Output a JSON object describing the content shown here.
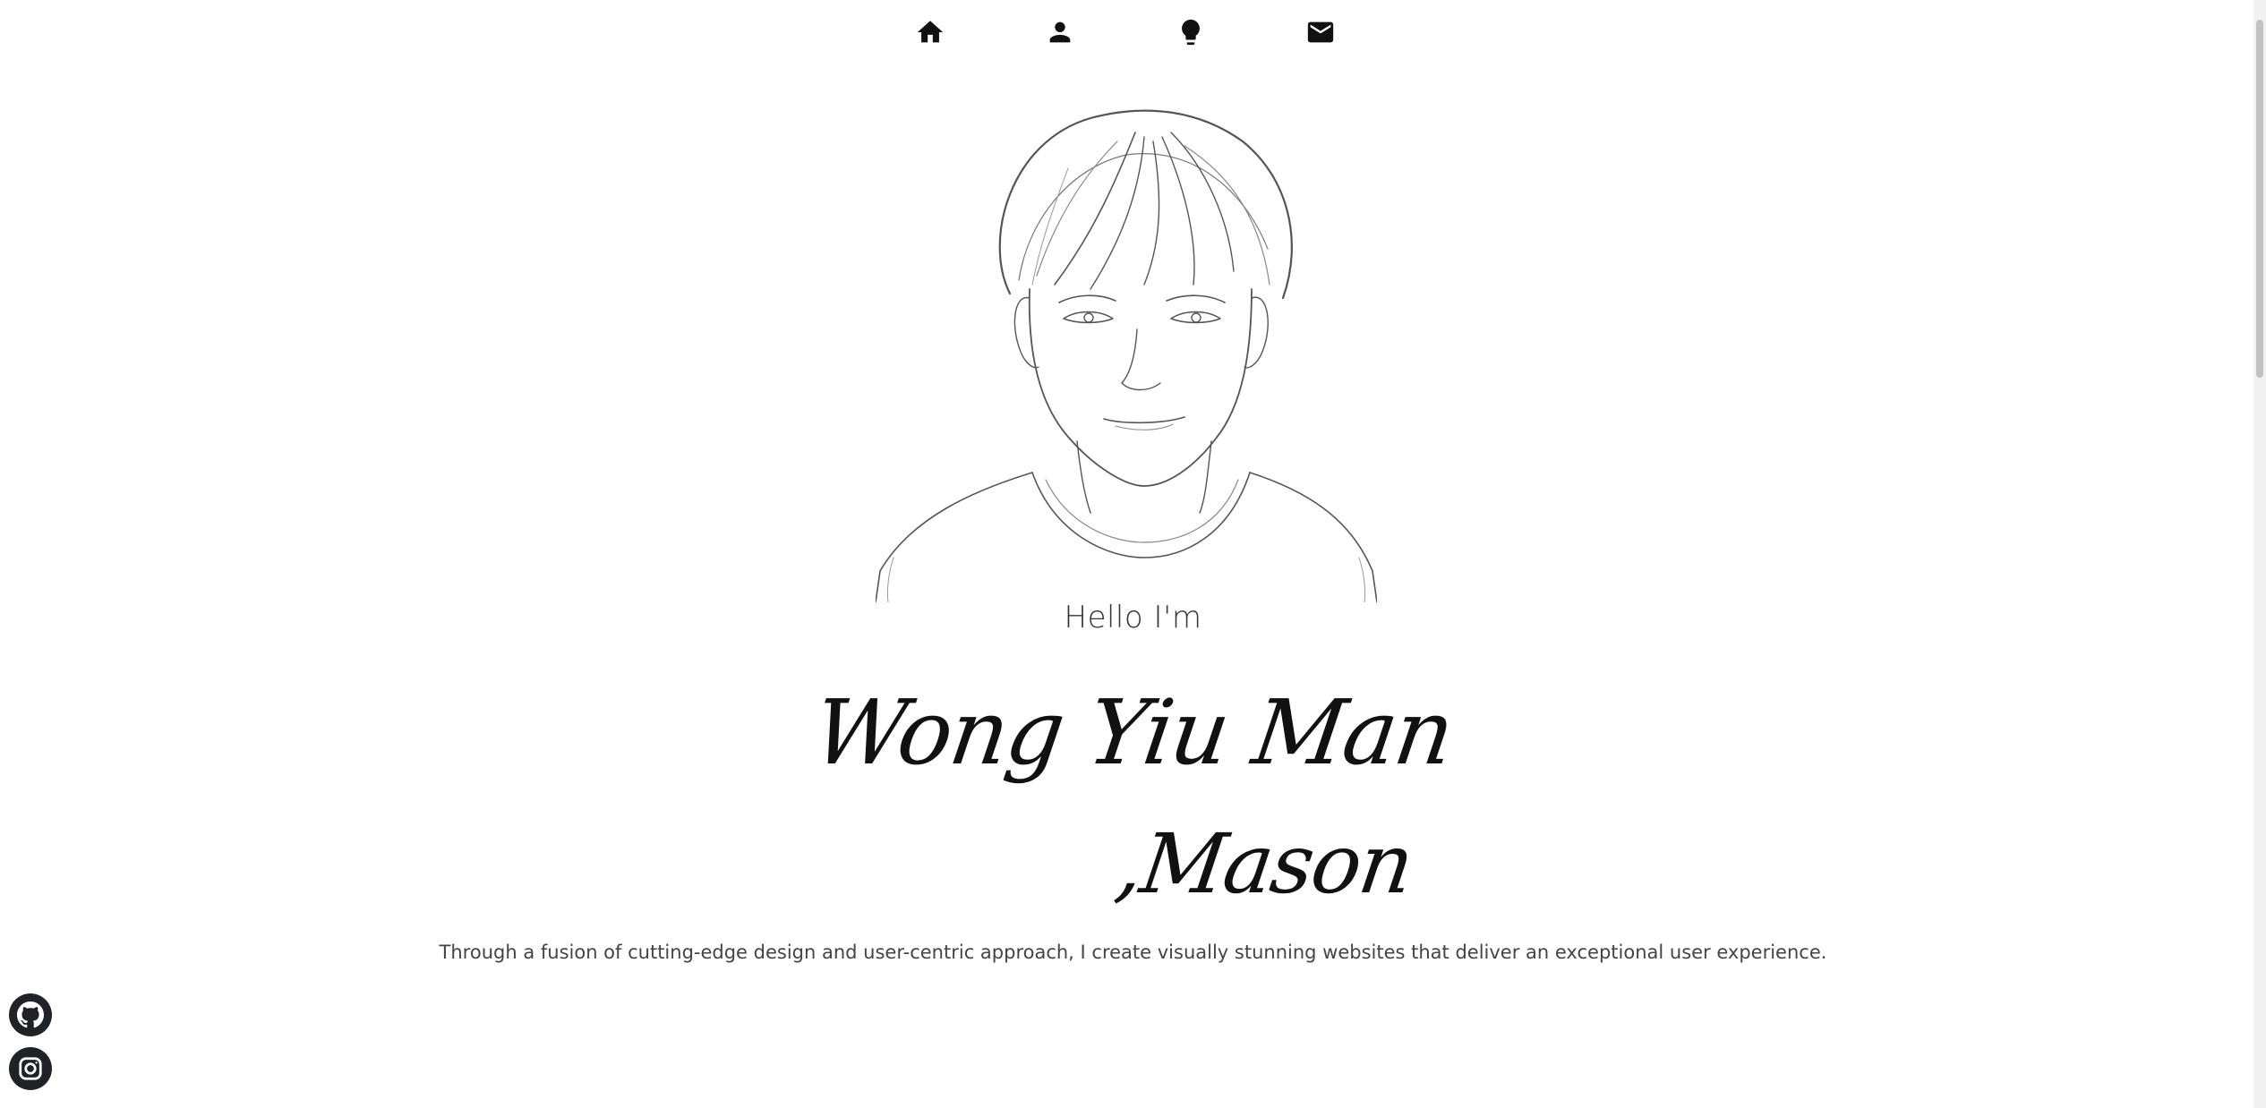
{
  "nav": {
    "items": [
      {
        "icon": "home-icon",
        "label": ""
      },
      {
        "icon": "person-icon",
        "label": ""
      },
      {
        "icon": "lightbulb-icon",
        "label": ""
      },
      {
        "icon": "mail-icon",
        "label": ""
      }
    ]
  },
  "hero": {
    "greeting": "Hello I'm",
    "name_line1": "Wong Yiu Man",
    "name_line2": ",Mason",
    "tagline": "Through a fusion of cutting-edge design and user-centric approach, I create visually stunning websites that deliver an exceptional user experience."
  },
  "social": {
    "items": [
      {
        "icon": "github-icon"
      },
      {
        "icon": "instagram-icon"
      }
    ]
  },
  "colors": {
    "text": "#111111",
    "social_bg": "#1f2328"
  }
}
